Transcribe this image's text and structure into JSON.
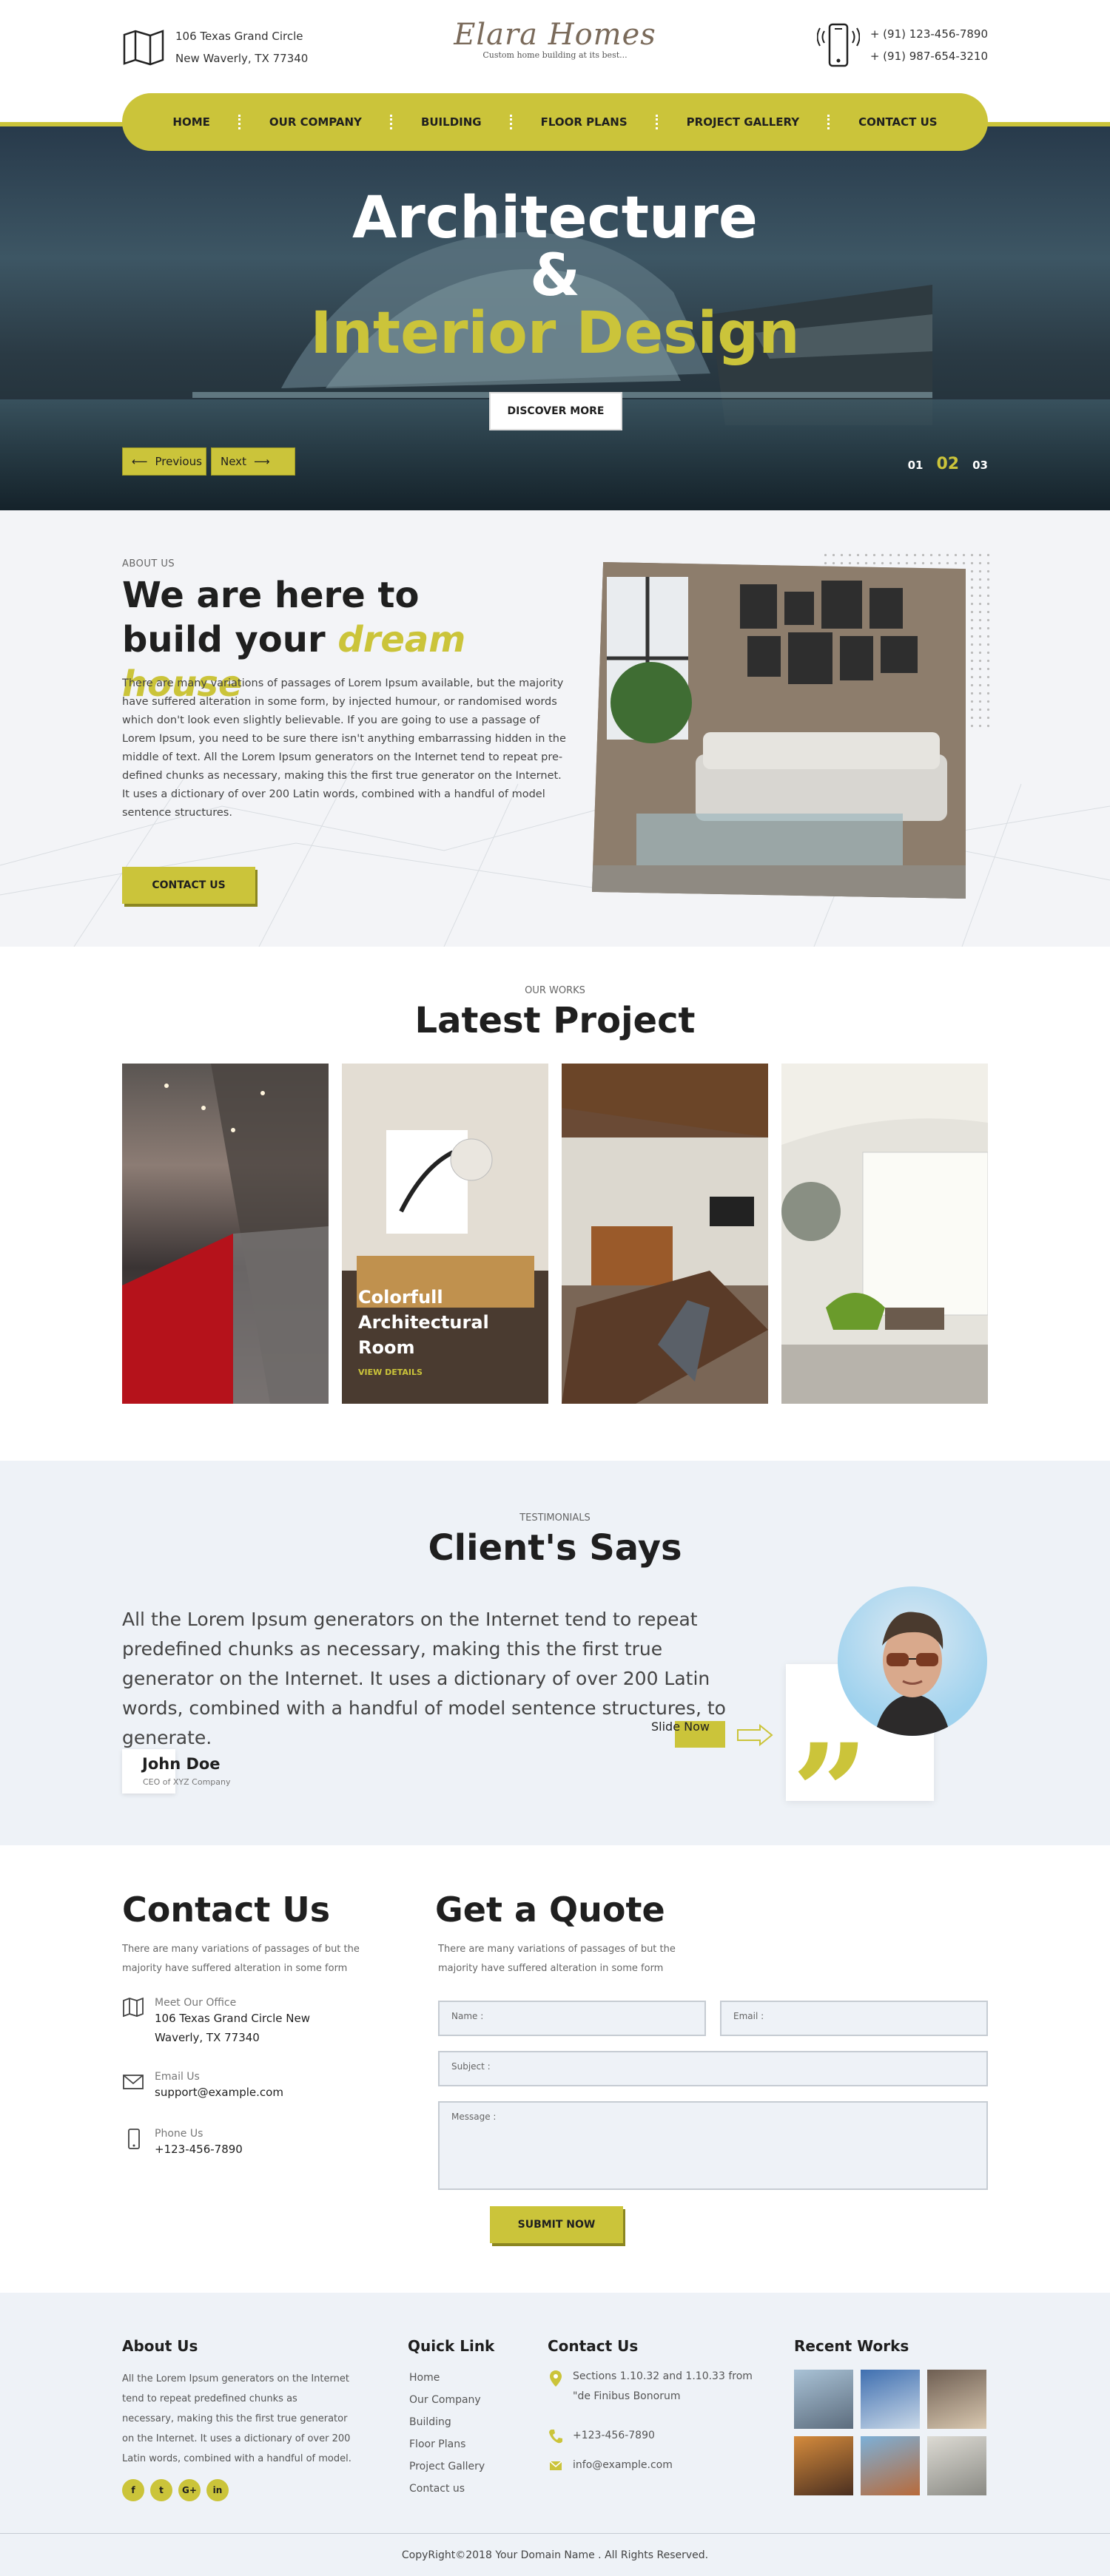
{
  "header": {
    "address_line1": "106 Texas Grand Circle",
    "address_line2": "New Waverly, TX 77340",
    "logo_text": "Elara Homes",
    "logo_tagline": "Custom home building at its best...",
    "phone1": "+ (91) 123-456-7890",
    "phone2": "+ (91) 987-654-3210"
  },
  "nav": {
    "items": [
      "HOME",
      "OUR COMPANY",
      "BUILDING",
      "FLOOR PLANS",
      "PROJECT GALLERY",
      "CONTACT US"
    ]
  },
  "hero": {
    "line1": "Architecture",
    "line2": "&",
    "line3": "Interior Design",
    "cta": "DISCOVER MORE",
    "prev": "Previous",
    "next": "Next",
    "slides": [
      "01",
      "02",
      "03"
    ],
    "active_slide": "02"
  },
  "about": {
    "label": "ABOUT US",
    "title_part1": "We are here to",
    "title_part2": "build your ",
    "title_highlight": "dream house",
    "body": "There are many variations of passages of Lorem Ipsum available, but the majority have suffered alteration in some form, by injected humour, or randomised words which don't look even slightly believable. If you are going to use a passage of Lorem Ipsum, you need to be sure there isn't anything embarrassing hidden in the middle of text. All the Lorem Ipsum generators on the Internet tend to repeat pre-defined chunks as necessary, making this the first true generator on the Internet. It uses a dictionary of over 200 Latin words, combined with a handful of model sentence structures.",
    "cta": "CONTACT US"
  },
  "projects": {
    "label": "OUR WORKS",
    "title": "Latest Project",
    "featured_title_line1": "Colorfull",
    "featured_title_line2": "Architectural Room",
    "featured_link": "VIEW DETAILS"
  },
  "testimonials": {
    "label": "TESTIMONIALS",
    "title": "Client's Says",
    "quote": "All the Lorem Ipsum generators on the Internet tend to repeat predefined chunks as necessary, making this the first true generator on the Internet. It uses a dictionary of over 200 Latin words, combined with a handful of model sentence structures, to generate.",
    "name": "John Doe",
    "role": "CEO of XYZ Company",
    "slide_label": "Slide Now"
  },
  "contact": {
    "title": "Contact Us",
    "sub": "There are many variations of passages of but the majority have suffered alteration in some form",
    "office_label": "Meet Our Office",
    "office_value": "106 Texas Grand Circle New Waverly, TX 77340",
    "email_label": "Email Us",
    "email_value": "support@example.com",
    "phone_label": "Phone Us",
    "phone_value": "+123-456-7890"
  },
  "quote": {
    "title": "Get a Quote",
    "sub": "There are many variations of passages of but the majority have suffered alteration in some form",
    "name_ph": "Name :",
    "email_ph": "Email :",
    "subject_ph": "Subject :",
    "message_ph": "Message :",
    "submit": "SUBMIT NOW"
  },
  "footer": {
    "about_title": "About Us",
    "about_text": "All the Lorem Ipsum generators on the Internet tend to repeat predefined chunks as necessary, making this the first true generator on the Internet. It uses a dictionary of over 200 Latin words, combined with a handful of model.",
    "social": [
      "f",
      "t",
      "G+",
      "in"
    ],
    "quick_title": "Quick Link",
    "quick_links": [
      "Home",
      "Our Company",
      "Building",
      "Floor Plans",
      "Project Gallery",
      "Contact us"
    ],
    "contact_title": "Contact Us",
    "contact_address": "Sections 1.10.32 and 1.10.33 from \"de Finibus Bonorum",
    "contact_phone": "+123-456-7890",
    "contact_email": "info@example.com",
    "works_title": "Recent Works",
    "copyright": "CopyRight©2018 Your Domain Name . All Rights Reserved."
  },
  "colors": {
    "accent": "#cbc43a",
    "dark": "#1f1f1f",
    "light_bg": "#eef2f7"
  }
}
